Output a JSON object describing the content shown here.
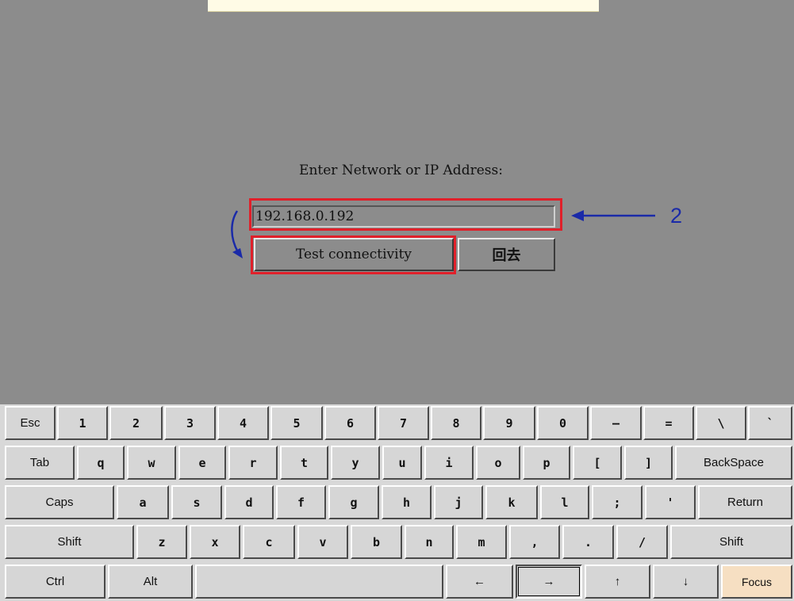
{
  "dialog": {
    "prompt": "Enter Network or IP Address:",
    "ip_value": "192.168.0.192",
    "test_button": "Test connectivity",
    "back_button": "回去"
  },
  "annotation": {
    "number": "2",
    "color": "#1a2aa8",
    "highlight_color": "#e0202a"
  },
  "keyboard": {
    "row1": [
      "Esc",
      "1",
      "2",
      "3",
      "4",
      "5",
      "6",
      "7",
      "8",
      "9",
      "0",
      "–",
      "=",
      "\\",
      "`"
    ],
    "row2": [
      "Tab",
      "q",
      "w",
      "e",
      "r",
      "t",
      "y",
      "u",
      "i",
      "o",
      "p",
      "[",
      "]",
      "BackSpace"
    ],
    "row3": [
      "Caps",
      "a",
      "s",
      "d",
      "f",
      "g",
      "h",
      "j",
      "k",
      "l",
      ";",
      "'",
      "Return"
    ],
    "row4": [
      "Shift",
      "z",
      "x",
      "c",
      "v",
      "b",
      "n",
      "m",
      ",",
      ".",
      "/",
      "Shift"
    ],
    "row5": [
      "Ctrl",
      "Alt",
      "",
      "←",
      "→",
      "↑",
      "↓",
      "Focus"
    ]
  }
}
